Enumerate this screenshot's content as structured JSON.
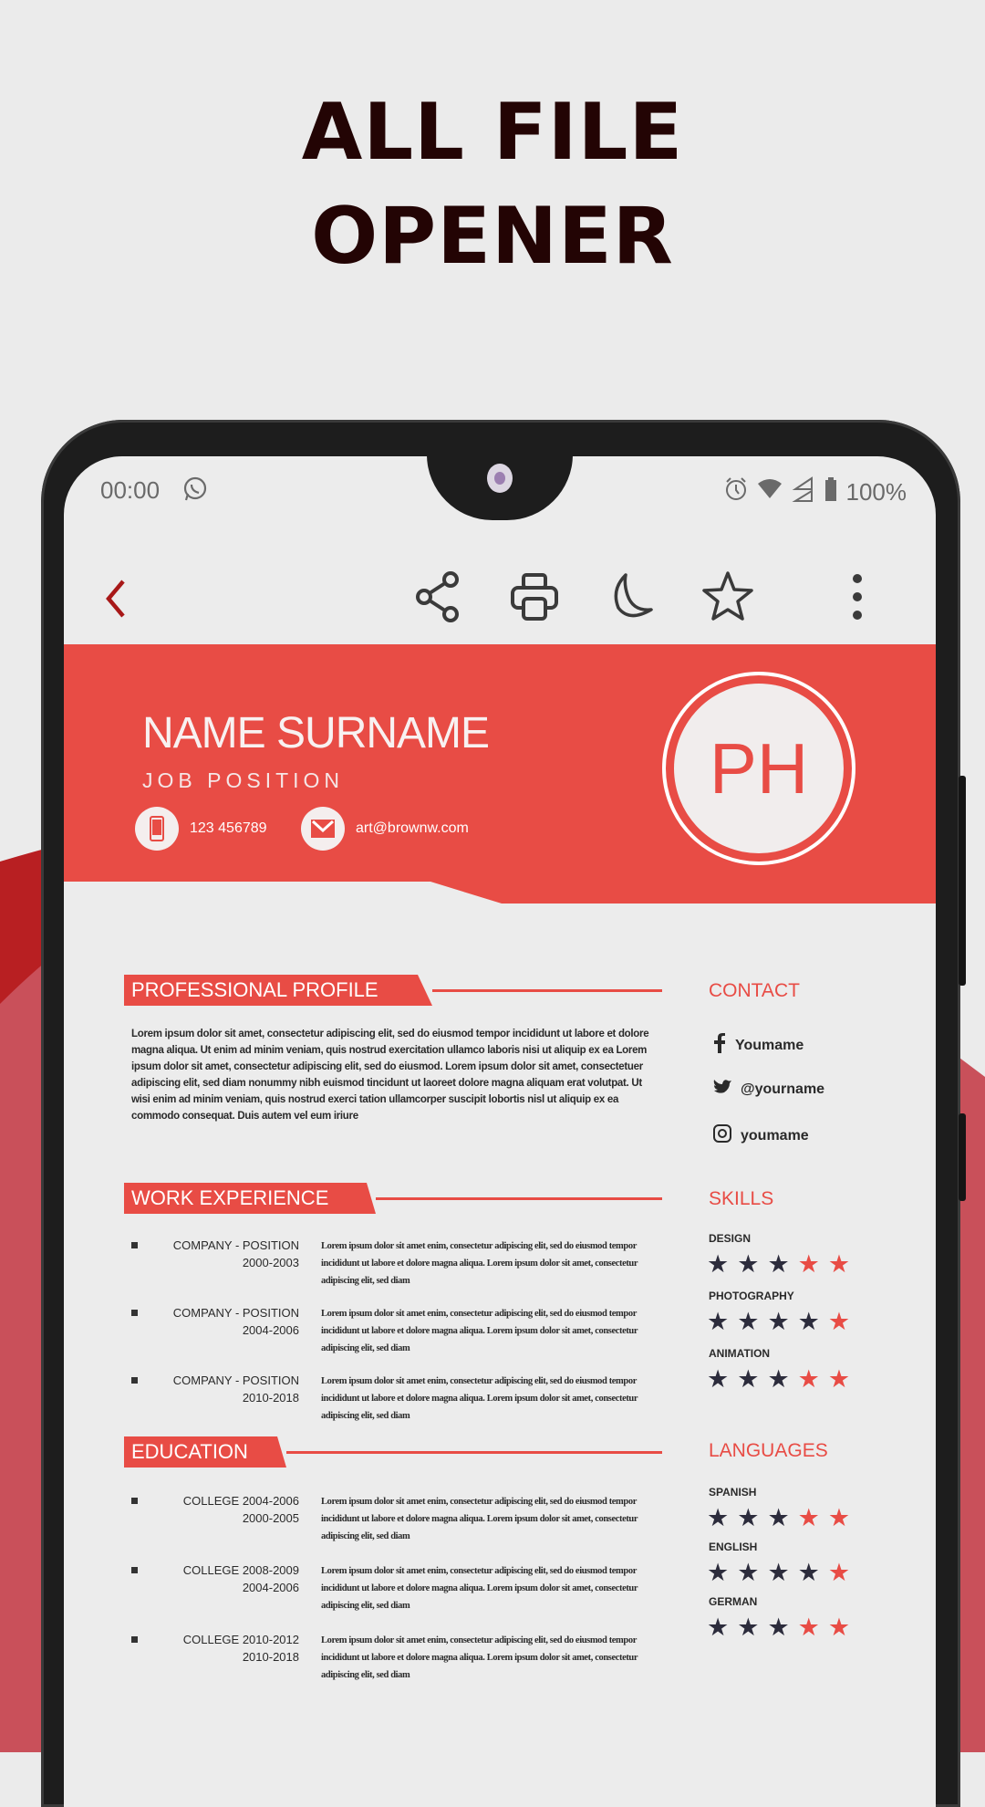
{
  "promo": {
    "headline_line1": "ALL FILE",
    "headline_line2": "OPENER"
  },
  "colors": {
    "accent": "#e84c45",
    "title": "#230404",
    "star_filled": "#2c2c3c",
    "star_empty": "#e84c45",
    "back_arrow": "#a81818"
  },
  "status_bar": {
    "time": "00:00",
    "battery": "100%",
    "icons": [
      "whatsapp-icon",
      "alarm-icon",
      "wifi-icon",
      "signal-icon",
      "battery-icon"
    ]
  },
  "toolbar": {
    "actions": [
      "back",
      "share",
      "print",
      "night-mode",
      "favorite",
      "more"
    ]
  },
  "resume": {
    "name": "NAME SURNAME",
    "job": "JOB POSITION",
    "phone": "123 456789",
    "email": "art@brownw.com",
    "initials": "PH",
    "sections": {
      "profile": "PROFESSIONAL PROFILE",
      "work": "WORK EXPERIENCE",
      "education": "EDUCATION",
      "contact": "CONTACT",
      "skills": "SKILLS",
      "languages": "LANGUAGES"
    },
    "profile_text": "Lorem ipsum dolor sit amet, consectetur adipiscing elit, sed do eiusmod tempor incididunt ut labore et dolore magna aliqua. Ut enim ad minim veniam, quis nostrud exercitation ullamco laboris nisi ut aliquip ex ea Lorem ipsum dolor sit amet, consectetur adipiscing elit, sed do eiusmod. Lorem ipsum dolor sit amet, consectetuer adipiscing elit, sed diam nonummy nibh euismod tincidunt ut laoreet dolore magna aliquam erat volutpat. Ut wisi enim ad minim veniam, quis nostrud exerci tation ullamcorper suscipit lobortis nisl ut aliquip ex ea commodo consequat. Duis autem vel eum iriure",
    "work": [
      {
        "title": "COMPANY - POSITION",
        "dates": "2000-2003",
        "desc": "Lorem ipsum dolor sit amet enim, consectetur adipiscing elit, sed do eiusmod tempor incididunt ut labore et dolore magna aliqua. Lorem ipsum dolor sit amet, consectetur adipiscing elit, sed diam"
      },
      {
        "title": "COMPANY - POSITION",
        "dates": "2004-2006",
        "desc": "Lorem ipsum dolor sit amet enim, consectetur adipiscing elit, sed do eiusmod tempor incididunt ut labore et dolore magna aliqua. Lorem ipsum dolor sit amet, consectetur adipiscing elit, sed diam"
      },
      {
        "title": "COMPANY - POSITION",
        "dates": "2010-2018",
        "desc": "Lorem ipsum dolor sit amet enim, consectetur adipiscing elit, sed do eiusmod tempor incididunt ut labore et dolore magna aliqua. Lorem ipsum dolor sit amet, consectetur adipiscing elit, sed diam"
      }
    ],
    "education": [
      {
        "title": "COLLEGE 2004-2006",
        "dates": "2000-2005",
        "desc": "Lorem ipsum dolor sit amet enim, consectetur adipiscing elit, sed do eiusmod tempor incididunt ut labore et dolore magna aliqua. Lorem ipsum dolor sit amet, consectetur adipiscing elit, sed diam"
      },
      {
        "title": "COLLEGE 2008-2009",
        "dates": "2004-2006",
        "desc": "Lorem ipsum dolor sit amet enim, consectetur adipiscing elit, sed do eiusmod tempor incididunt ut labore et dolore magna aliqua. Lorem ipsum dolor sit amet, consectetur adipiscing elit, sed diam"
      },
      {
        "title": "COLLEGE 2010-2012",
        "dates": "2010-2018",
        "desc": "Lorem ipsum dolor sit amet enim, consectetur adipiscing elit, sed do eiusmod tempor incididunt ut labore et dolore magna aliqua. Lorem ipsum dolor sit amet, consectetur adipiscing elit, sed diam"
      }
    ],
    "social": [
      {
        "icon": "facebook-icon",
        "handle": "Youmame"
      },
      {
        "icon": "twitter-icon",
        "handle": "@yourname"
      },
      {
        "icon": "instagram-icon",
        "handle": "youmame"
      }
    ],
    "skills": [
      {
        "label": "DESIGN",
        "rating": 3,
        "max": 5
      },
      {
        "label": "PHOTOGRAPHY",
        "rating": 4,
        "max": 5
      },
      {
        "label": "ANIMATION",
        "rating": 3,
        "max": 5
      }
    ],
    "languages": [
      {
        "label": "SPANISH",
        "rating": 3,
        "max": 5
      },
      {
        "label": "ENGLISH",
        "rating": 4,
        "max": 5
      },
      {
        "label": "GERMAN",
        "rating": 3,
        "max": 5
      }
    ]
  }
}
